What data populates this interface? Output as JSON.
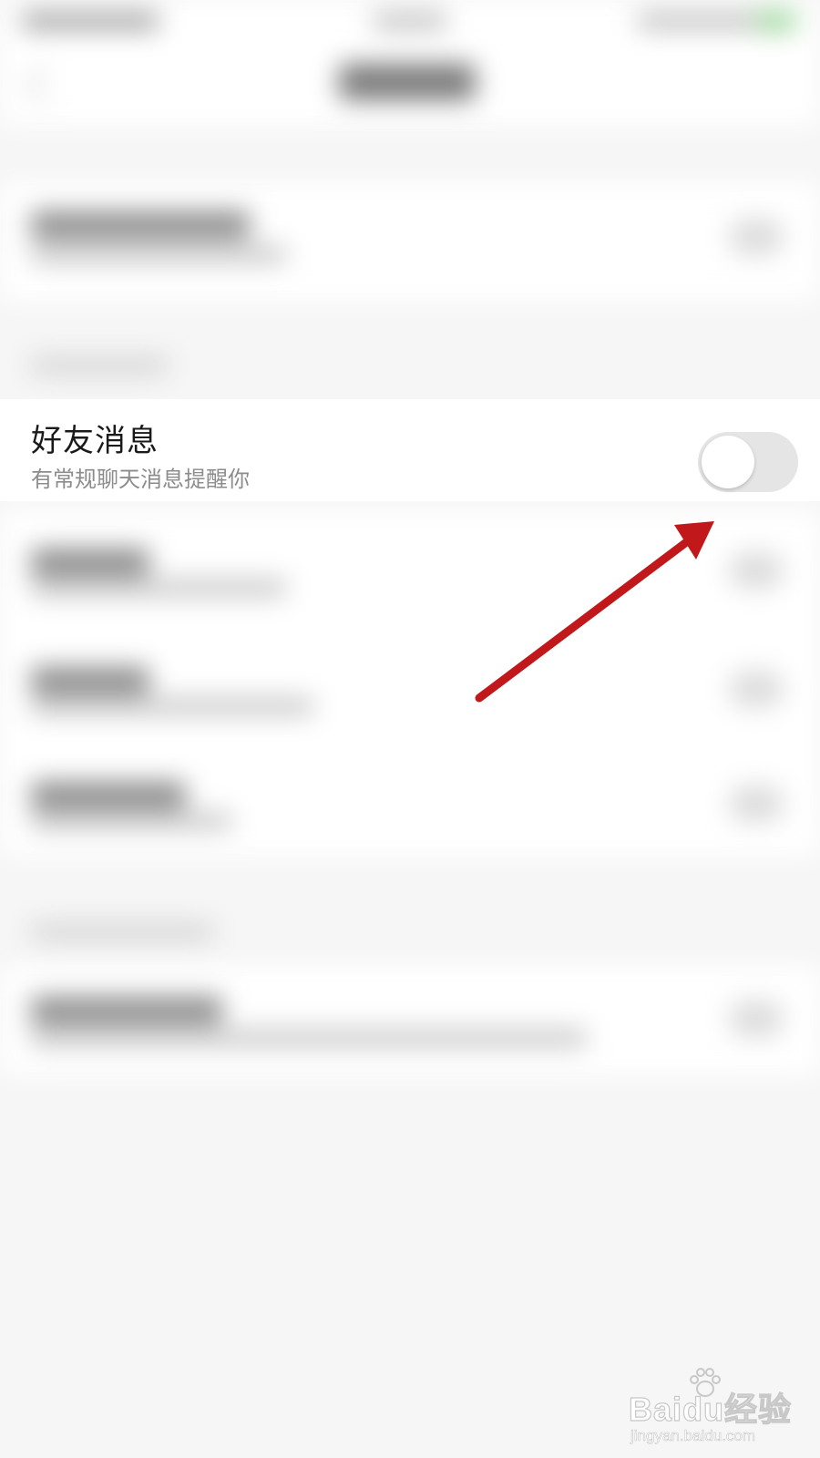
{
  "notification_setting": {
    "title": "好友消息",
    "subtitle": "有常规聊天消息提醒你",
    "enabled": false
  },
  "annotation": {
    "arrow_color": "#c0181b",
    "arrow_target": "toggle-switch"
  },
  "watermark": {
    "brand": "Baidu经验",
    "url": "jingyan.baidu.com"
  },
  "colors": {
    "background": "#f6f6f6",
    "toggle_off_track": "#e5e5e5",
    "toggle_knob": "#ffffff"
  }
}
